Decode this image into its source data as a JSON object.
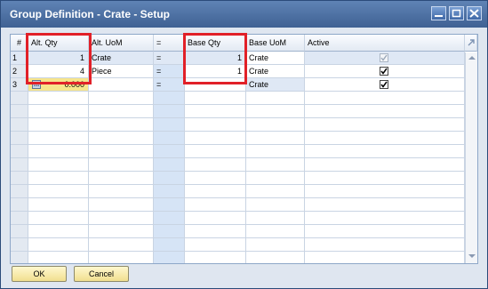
{
  "window": {
    "title": "Group Definition - Crate - Setup"
  },
  "grid": {
    "columns": [
      "#",
      "Alt. Qty",
      "Alt. UoM",
      "=",
      "Base Qty",
      "Base UoM",
      "Active"
    ],
    "rows": [
      {
        "num": "1",
        "alt_qty": "1",
        "alt_uom": "Crate",
        "eq": "=",
        "base_qty": "1",
        "base_uom": "Crate",
        "active": true,
        "active_disabled": true
      },
      {
        "num": "2",
        "alt_qty": "4",
        "alt_uom": "Piece",
        "eq": "=",
        "base_qty": "1",
        "base_uom": "Crate",
        "active": true,
        "active_disabled": false
      },
      {
        "num": "3",
        "alt_qty": "0.000",
        "alt_uom": "",
        "eq": "=",
        "base_qty": "",
        "base_uom": "Crate",
        "active": true,
        "active_disabled": false
      }
    ]
  },
  "buttons": {
    "ok": "OK",
    "cancel": "Cancel"
  },
  "colors": {
    "title_bar": "#4a6fa5",
    "highlight": "#e12028",
    "button": "#f6e7a6",
    "qty_input": "#f7e58c"
  }
}
